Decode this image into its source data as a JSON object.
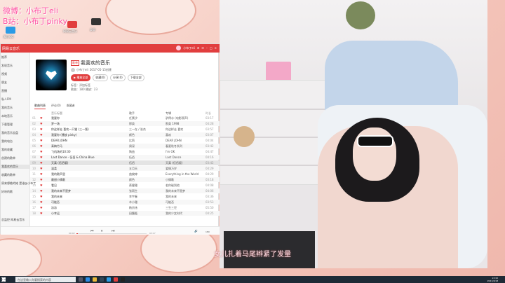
{
  "overlay": {
    "line1": "微博：小布丁eli",
    "line2": "B站：小布丁pinky",
    "subtitle": "女儿扎着马尾辫紧了发量"
  },
  "desktop_icons": [
    {
      "label": "腾讯QQ",
      "color": "#2a9be6"
    },
    {
      "label": "网易云音乐",
      "color": "#e13e3e"
    },
    {
      "label": "录屏",
      "color": "#333"
    }
  ],
  "window": {
    "app": "网易云音乐",
    "user": "小布丁eli"
  },
  "sidebar": {
    "items": [
      "推荐",
      "发现音乐",
      "视频",
      "朋友",
      "直播",
      "私人FM",
      "我的音乐",
      "本地音乐",
      "下载管理",
      "我的音乐云盘",
      "我的电台",
      "我的收藏",
      "创建的歌单",
      "我喜欢的音乐",
      "收藏的歌单",
      "原来想着的她 是谁@小布丁",
      "好听的歌"
    ],
    "footer": "总监控 网易云音乐"
  },
  "playlist": {
    "tag": "歌单",
    "title": "我喜欢的音乐",
    "creator": "小布丁eli",
    "created": "2017-05-15创建",
    "play_all": "▶ 播放全部",
    "collect": "收藏(0)",
    "share": "分享(0)",
    "download": "下载全部",
    "tags_line": "标签：添加标签",
    "count_line": "歌曲：180  播放：23"
  },
  "tabs": [
    "歌曲列表",
    "评论(0)",
    "收藏者"
  ],
  "columns": {
    "title": "音乐标题",
    "artist": "歌手",
    "album": "专辑",
    "time": "时长"
  },
  "songs": [
    {
      "n": "01",
      "title": "我要你",
      "artist": "任素汐",
      "album": "驴得水 (电影原声)",
      "time": "03:17"
    },
    {
      "n": "02",
      "title": "梦一场",
      "artist": "那英",
      "album": "那英 1998",
      "time": "04:28"
    },
    {
      "n": "03",
      "title": "你这样走 喜欢一只猫 (三一版)",
      "artist": "三一在 / 张杰",
      "album": "你这样走 喜欢",
      "time": "03:57"
    },
    {
      "n": "04",
      "title": "我要你 (播放 pinky)",
      "artist": "颜色",
      "album": "喜欢",
      "time": "03:07"
    },
    {
      "n": "05",
      "title": "DEAR JOHN",
      "artist": "比莉",
      "album": "DEAR JOHN",
      "time": "04:04"
    },
    {
      "n": "06",
      "title": "青梅竹马",
      "artist": "周深",
      "album": "春夏秋冬系列",
      "time": "03:42"
    },
    {
      "n": "07",
      "title": "飞机场的10:30",
      "artist": "陶喆",
      "album": "I'm OK",
      "time": "04:47"
    },
    {
      "n": "08",
      "title": "Last Dance - 伍佰 & China Blue",
      "artist": "伍佰",
      "album": "Last Dance",
      "time": "04:16"
    },
    {
      "n": "09",
      "title": "天真 (伍佰版)",
      "artist": "伍佰",
      "album": "天真 (伍佰版)",
      "time": "03:42"
    },
    {
      "n": "10",
      "title": "温柔",
      "artist": "五月天",
      "album": "爱情万岁",
      "time": "04:29"
    },
    {
      "n": "11",
      "title": "我的歌声里",
      "artist": "曲婉婷",
      "album": "Everything in the World",
      "time": "04:29"
    },
    {
      "n": "12",
      "title": "最甜小情歌",
      "artist": "颜色",
      "album": "小情歌",
      "time": "03:18"
    },
    {
      "n": "13",
      "title": "看见",
      "artist": "蔡健雅",
      "album": "若你碰到他",
      "time": "04:08"
    },
    {
      "n": "14",
      "title": "我的未来不是梦",
      "artist": "张雨生",
      "album": "我的未来不是梦",
      "time": "04:06"
    },
    {
      "n": "15",
      "title": "我的未来",
      "artist": "李宇春",
      "album": "我的未来",
      "time": "03:36"
    },
    {
      "n": "16",
      "title": "可能否",
      "artist": "木小雅",
      "album": "可能否",
      "time": "03:53"
    },
    {
      "n": "17",
      "title": "凉凉",
      "artist": "杨宗纬",
      "album": "三生三世",
      "time": "05:50"
    },
    {
      "n": "18",
      "title": "小幸运",
      "artist": "田馥甄",
      "album": "我的少女时代",
      "time": "04:25"
    }
  ],
  "player": {
    "elapsed": "00:02",
    "total": "03:17",
    "progress": 0.02,
    "playlist_count": "180"
  },
  "taskbar": {
    "search": "在这里输入你要搜索的内容",
    "time": "13:32",
    "date": "2021/4/18"
  }
}
